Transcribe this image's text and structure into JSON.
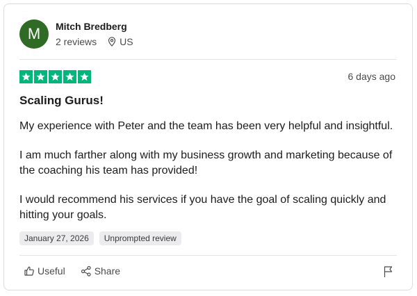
{
  "reviewer": {
    "initial": "M",
    "name": "Mitch Bredberg",
    "reviews": "2 reviews",
    "country": "US",
    "avatar_color": "#2f6b24"
  },
  "review": {
    "rating": 5,
    "star_color": "#00b67a",
    "date_ago": "6 days ago",
    "title": "Scaling Gurus!",
    "paragraphs": [
      "My experience with Peter and the team has been very helpful and insightful.",
      "I am much farther along with my business growth and marketing because of the coaching his team has provided!",
      "I would recommend his services if you have the goal of scaling quickly and hitting your goals."
    ],
    "date": "January 27, 2026",
    "tag": "Unprompted review"
  },
  "actions": {
    "useful_label": "Useful",
    "share_label": "Share",
    "useful_icon": "thumbs-up-icon",
    "share_icon": "share-icon",
    "flag_icon": "flag-icon"
  }
}
